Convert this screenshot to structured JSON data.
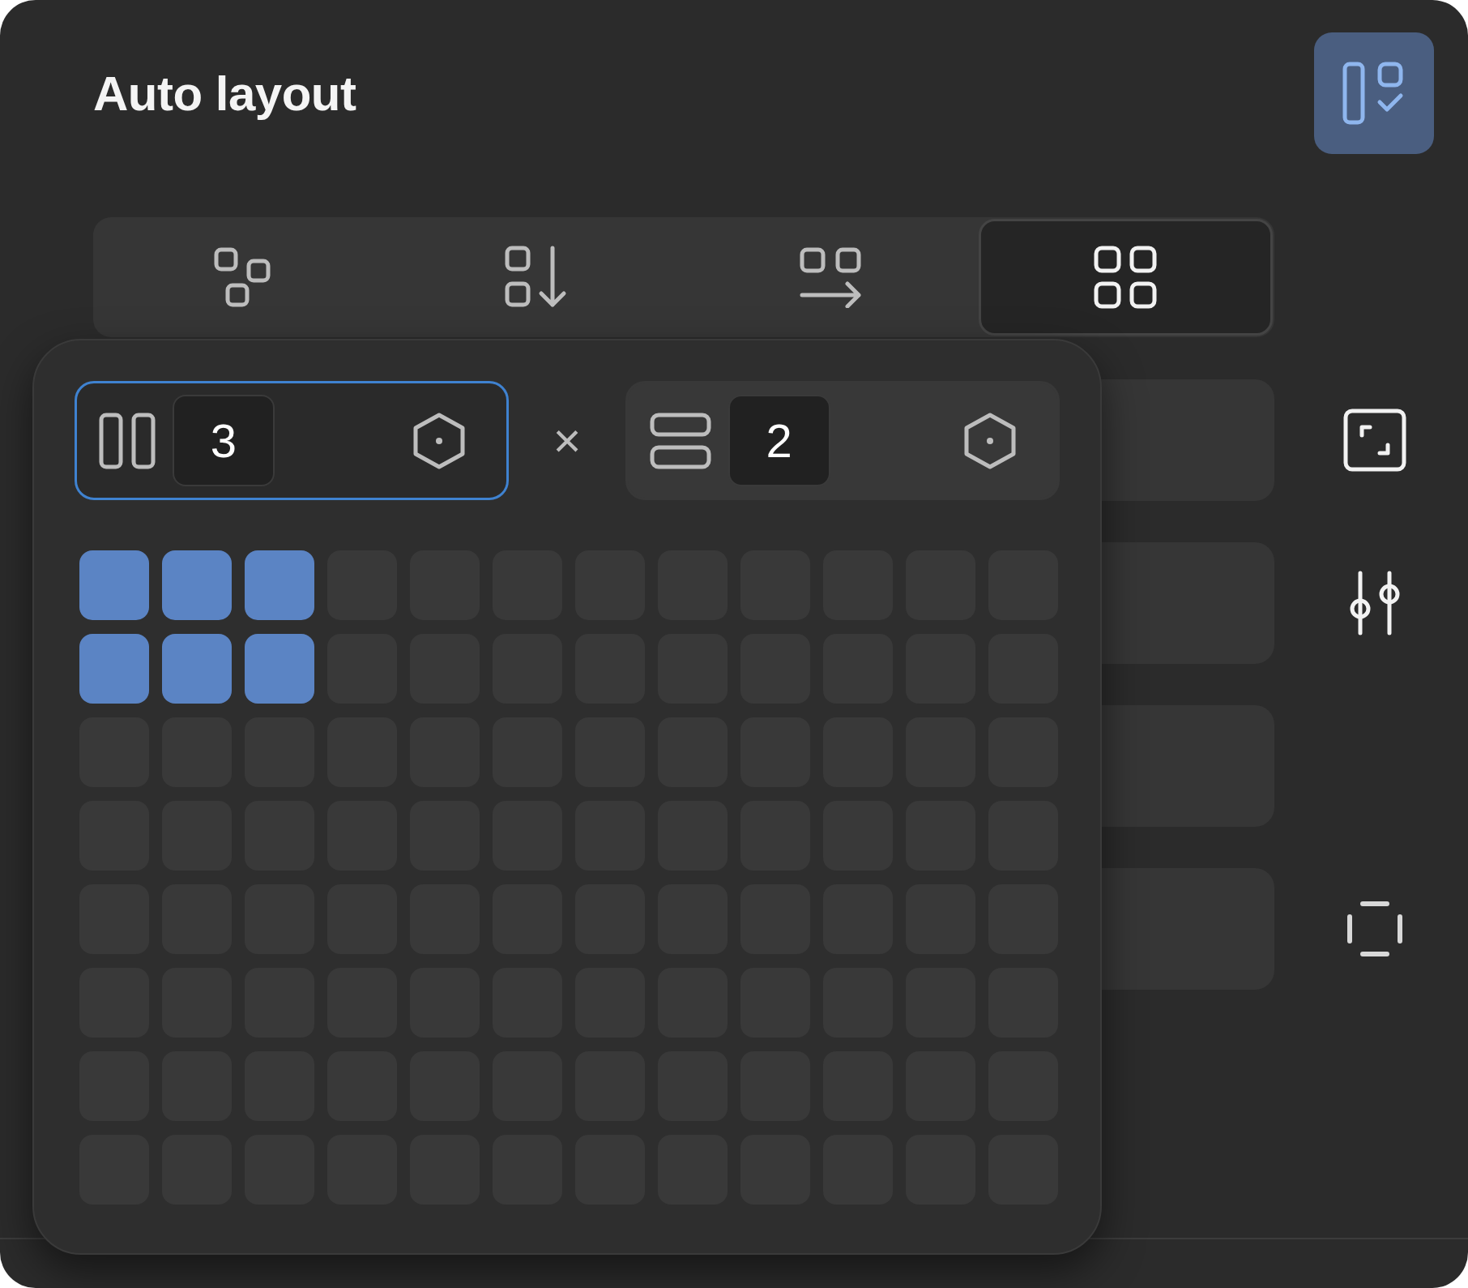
{
  "title": "Auto layout",
  "tabs": [
    {
      "selected": false
    },
    {
      "selected": false
    },
    {
      "selected": false
    },
    {
      "selected": true
    }
  ],
  "columns_field": {
    "value": "3",
    "focused": true
  },
  "separator": "×",
  "rows_field": {
    "value": "2",
    "focused": false
  },
  "grid": [
    [
      {
        "selected": true
      },
      {
        "selected": true
      },
      {
        "selected": true
      },
      {
        "selected": false
      },
      {
        "selected": false
      },
      {
        "selected": false
      },
      {
        "selected": false
      },
      {
        "selected": false
      },
      {
        "selected": false
      },
      {
        "selected": false
      },
      {
        "selected": false
      },
      {
        "selected": false
      }
    ],
    [
      {
        "selected": true
      },
      {
        "selected": true
      },
      {
        "selected": true
      },
      {
        "selected": false
      },
      {
        "selected": false
      },
      {
        "selected": false
      },
      {
        "selected": false
      },
      {
        "selected": false
      },
      {
        "selected": false
      },
      {
        "selected": false
      },
      {
        "selected": false
      },
      {
        "selected": false
      }
    ],
    [
      {
        "selected": false
      },
      {
        "selected": false
      },
      {
        "selected": false
      },
      {
        "selected": false
      },
      {
        "selected": false
      },
      {
        "selected": false
      },
      {
        "selected": false
      },
      {
        "selected": false
      },
      {
        "selected": false
      },
      {
        "selected": false
      },
      {
        "selected": false
      },
      {
        "selected": false
      }
    ],
    [
      {
        "selected": false
      },
      {
        "selected": false
      },
      {
        "selected": false
      },
      {
        "selected": false
      },
      {
        "selected": false
      },
      {
        "selected": false
      },
      {
        "selected": false
      },
      {
        "selected": false
      },
      {
        "selected": false
      },
      {
        "selected": false
      },
      {
        "selected": false
      },
      {
        "selected": false
      }
    ],
    [
      {
        "selected": false
      },
      {
        "selected": false
      },
      {
        "selected": false
      },
      {
        "selected": false
      },
      {
        "selected": false
      },
      {
        "selected": false
      },
      {
        "selected": false
      },
      {
        "selected": false
      },
      {
        "selected": false
      },
      {
        "selected": false
      },
      {
        "selected": false
      },
      {
        "selected": false
      }
    ],
    [
      {
        "selected": false
      },
      {
        "selected": false
      },
      {
        "selected": false
      },
      {
        "selected": false
      },
      {
        "selected": false
      },
      {
        "selected": false
      },
      {
        "selected": false
      },
      {
        "selected": false
      },
      {
        "selected": false
      },
      {
        "selected": false
      },
      {
        "selected": false
      },
      {
        "selected": false
      }
    ],
    [
      {
        "selected": false
      },
      {
        "selected": false
      },
      {
        "selected": false
      },
      {
        "selected": false
      },
      {
        "selected": false
      },
      {
        "selected": false
      },
      {
        "selected": false
      },
      {
        "selected": false
      },
      {
        "selected": false
      },
      {
        "selected": false
      },
      {
        "selected": false
      },
      {
        "selected": false
      }
    ],
    [
      {
        "selected": false
      },
      {
        "selected": false
      },
      {
        "selected": false
      },
      {
        "selected": false
      },
      {
        "selected": false
      },
      {
        "selected": false
      },
      {
        "selected": false
      },
      {
        "selected": false
      },
      {
        "selected": false
      },
      {
        "selected": false
      },
      {
        "selected": false
      },
      {
        "selected": false
      }
    ]
  ]
}
